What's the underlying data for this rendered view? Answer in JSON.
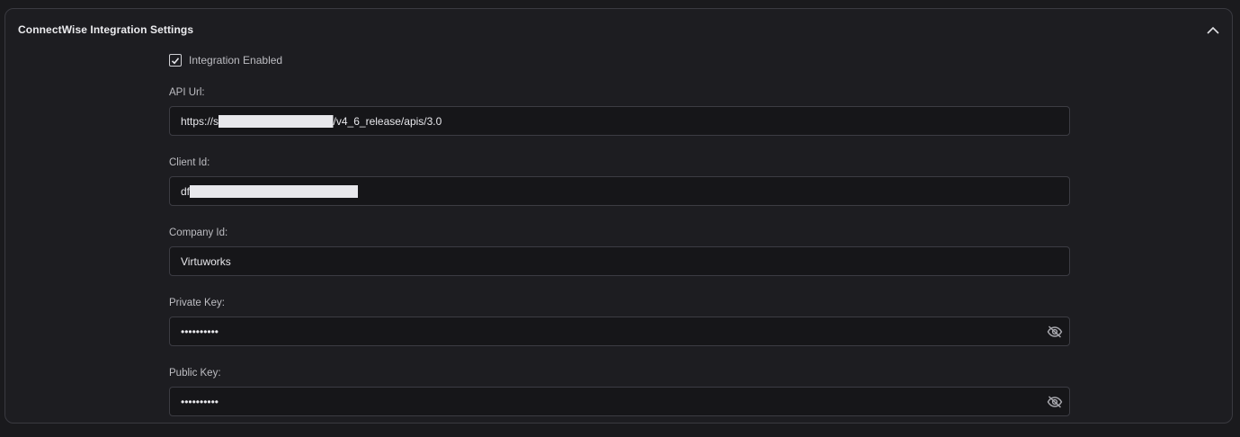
{
  "panel": {
    "title": "ConnectWise Integration Settings",
    "collapse_icon": "chevron-up-icon"
  },
  "integration": {
    "enabled_label": "Integration Enabled",
    "enabled": true
  },
  "fields": {
    "api_url": {
      "label": "API Url:",
      "value": "https://s███████████████/v4_6_release/apis/3.0"
    },
    "client_id": {
      "label": "Client Id:",
      "value": "df██████████████████████"
    },
    "company_id": {
      "label": "Company Id:",
      "value": "Virtuworks"
    },
    "private_key": {
      "label": "Private Key:",
      "value": "••••••••••",
      "toggle_icon": "eye-off-icon"
    },
    "public_key": {
      "label": "Public Key:",
      "value": "••••••••••",
      "toggle_icon": "eye-off-icon"
    }
  }
}
